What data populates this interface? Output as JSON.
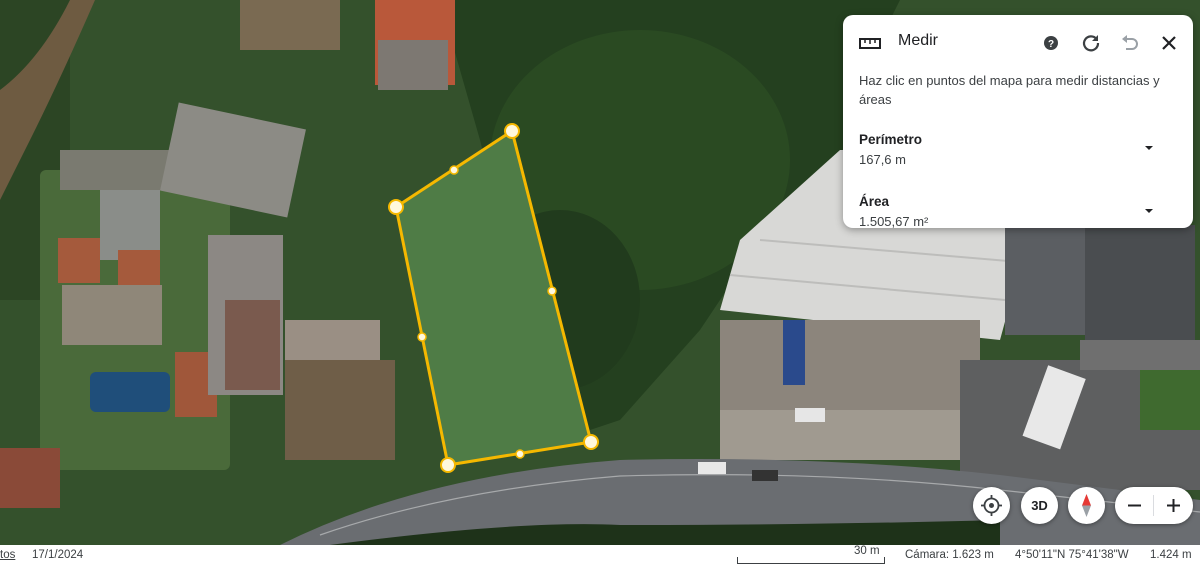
{
  "measure_panel": {
    "title": "Medir",
    "description": "Haz clic en puntos del mapa para medir distancias y áreas",
    "perimeter_label": "Perímetro",
    "perimeter_value": "167,6 m",
    "area_label": "Área",
    "area_value": "1.505,67 m²",
    "icons": [
      "ruler-icon",
      "help-icon",
      "refresh-icon",
      "undo-icon",
      "close-icon"
    ]
  },
  "map_controls": {
    "three_d_label": "3D",
    "icons": [
      "my-location-icon",
      "compass-icon",
      "zoom-out-icon",
      "zoom-in-icon"
    ]
  },
  "status_bar": {
    "partial_link": "tos",
    "date": "17/1/2024",
    "scale_label": "30 m",
    "camera": "Cámara: 1.623 m",
    "coordinates": "4°50'11\"N 75°41'38\"W",
    "elevation": "1.424 m"
  },
  "colors": {
    "measure_line": "#f5b800",
    "panel_bg": "#ffffff",
    "text_primary": "#202124"
  }
}
